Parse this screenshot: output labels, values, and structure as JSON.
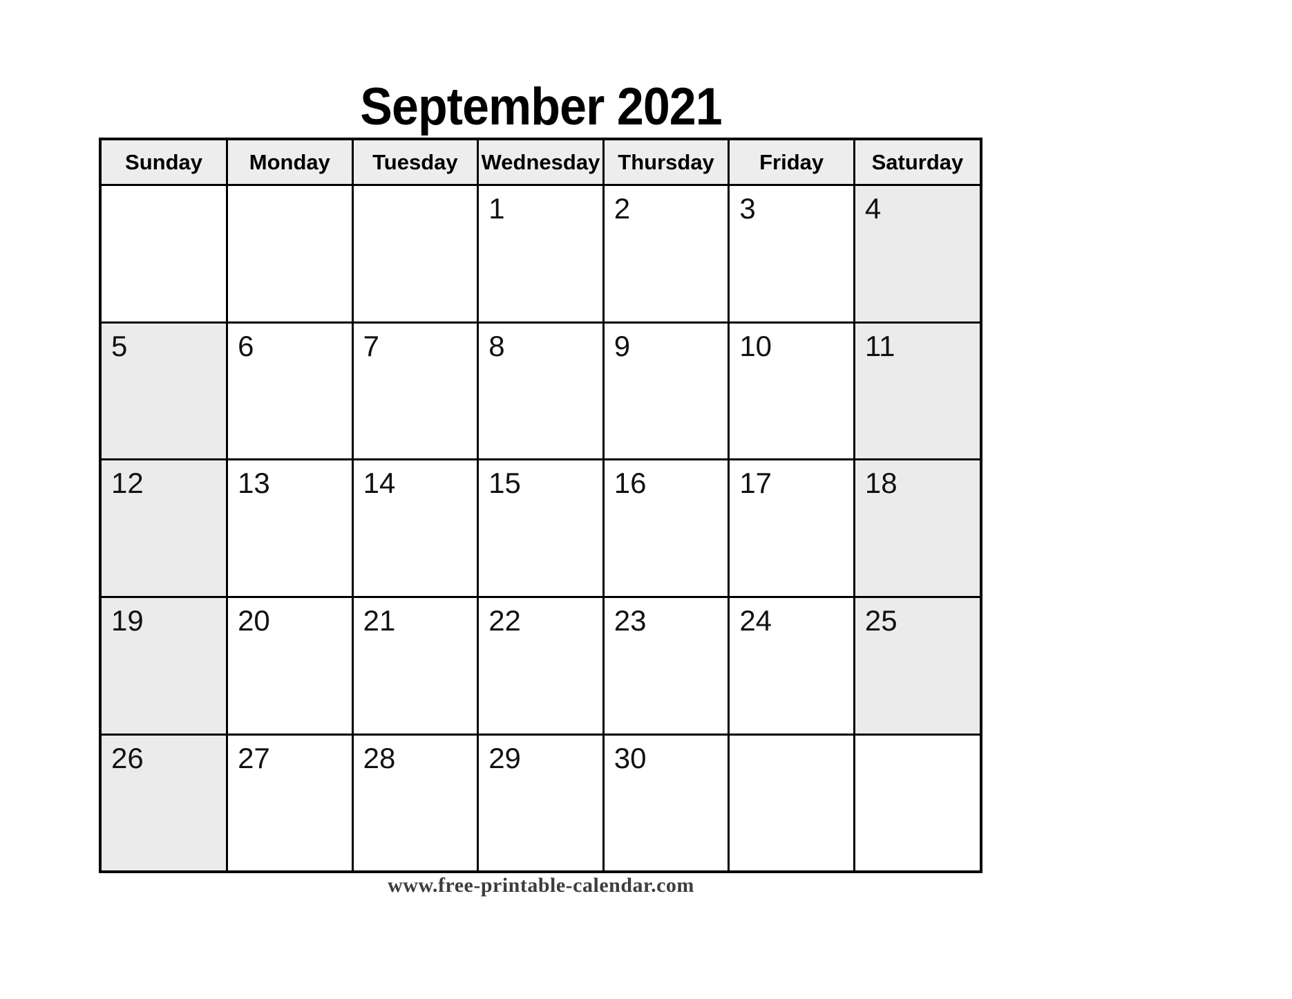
{
  "calendar": {
    "title": "September 2021",
    "month_name": "September",
    "year": "2021",
    "weekday_headers": [
      {
        "label": "Sunday"
      },
      {
        "label": "Monday"
      },
      {
        "label": "Tuesday"
      },
      {
        "label": "Wednesday"
      },
      {
        "label": "Thursday"
      },
      {
        "label": "Friday"
      },
      {
        "label": "Saturday"
      }
    ],
    "weeks": [
      {
        "days": [
          {
            "num": "",
            "shaded": false
          },
          {
            "num": "",
            "shaded": false
          },
          {
            "num": "",
            "shaded": false
          },
          {
            "num": "1",
            "shaded": false
          },
          {
            "num": "2",
            "shaded": false
          },
          {
            "num": "3",
            "shaded": false
          },
          {
            "num": "4",
            "shaded": true
          }
        ]
      },
      {
        "days": [
          {
            "num": "5",
            "shaded": true
          },
          {
            "num": "6",
            "shaded": false
          },
          {
            "num": "7",
            "shaded": false
          },
          {
            "num": "8",
            "shaded": false
          },
          {
            "num": "9",
            "shaded": false
          },
          {
            "num": "10",
            "shaded": false
          },
          {
            "num": "11",
            "shaded": true
          }
        ]
      },
      {
        "days": [
          {
            "num": "12",
            "shaded": true
          },
          {
            "num": "13",
            "shaded": false
          },
          {
            "num": "14",
            "shaded": false
          },
          {
            "num": "15",
            "shaded": false
          },
          {
            "num": "16",
            "shaded": false
          },
          {
            "num": "17",
            "shaded": false
          },
          {
            "num": "18",
            "shaded": true
          }
        ]
      },
      {
        "days": [
          {
            "num": "19",
            "shaded": true
          },
          {
            "num": "20",
            "shaded": false
          },
          {
            "num": "21",
            "shaded": false
          },
          {
            "num": "22",
            "shaded": false
          },
          {
            "num": "23",
            "shaded": false
          },
          {
            "num": "24",
            "shaded": false
          },
          {
            "num": "25",
            "shaded": true
          }
        ]
      },
      {
        "days": [
          {
            "num": "26",
            "shaded": true
          },
          {
            "num": "27",
            "shaded": false
          },
          {
            "num": "28",
            "shaded": false
          },
          {
            "num": "29",
            "shaded": false
          },
          {
            "num": "30",
            "shaded": false
          },
          {
            "num": "",
            "shaded": false
          },
          {
            "num": "",
            "shaded": false
          }
        ]
      }
    ]
  },
  "footer": {
    "website": "www.free-printable-calendar.com"
  },
  "colors": {
    "header_cell_fill": "#ededed",
    "shaded_cell_fill": "#ebebeb",
    "grid_line": "#000000",
    "page_background": "#ffffff",
    "title_text": "#000000",
    "footer_text": "#3d3d3d"
  }
}
